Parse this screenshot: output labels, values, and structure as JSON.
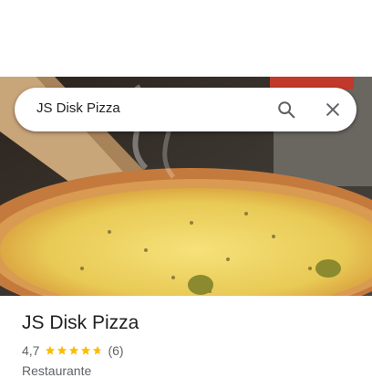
{
  "search": {
    "query": "JS Disk Pizza"
  },
  "place": {
    "name": "JS Disk Pizza",
    "rating": "4,7",
    "rating_value": 4.7,
    "stars_max": 5,
    "review_count": "(6)",
    "category": "Restaurante"
  },
  "icons": {
    "search": "search-icon",
    "close": "close-icon",
    "star": "star-icon"
  },
  "colors": {
    "star": "#fbbc04",
    "text_primary": "#202124",
    "text_secondary": "#5f6368"
  }
}
